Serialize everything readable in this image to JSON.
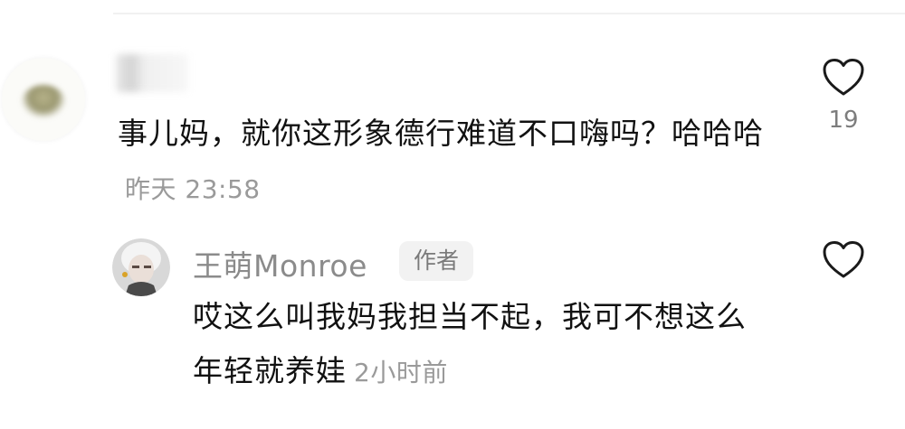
{
  "comment": {
    "text": "事儿妈，就你这形象德行难道不口嗨吗？哈哈哈",
    "time": "昨天 23:58",
    "likes": "19"
  },
  "reply": {
    "author": "王萌Monroe",
    "badge": "作者",
    "text": "哎这么叫我妈我担当不起，我可不想这么年轻就养娃",
    "time": "2小时前"
  },
  "colors": {
    "text_primary": "#111111",
    "text_secondary": "#9a9a9a",
    "badge_bg": "#f2f2f2"
  }
}
